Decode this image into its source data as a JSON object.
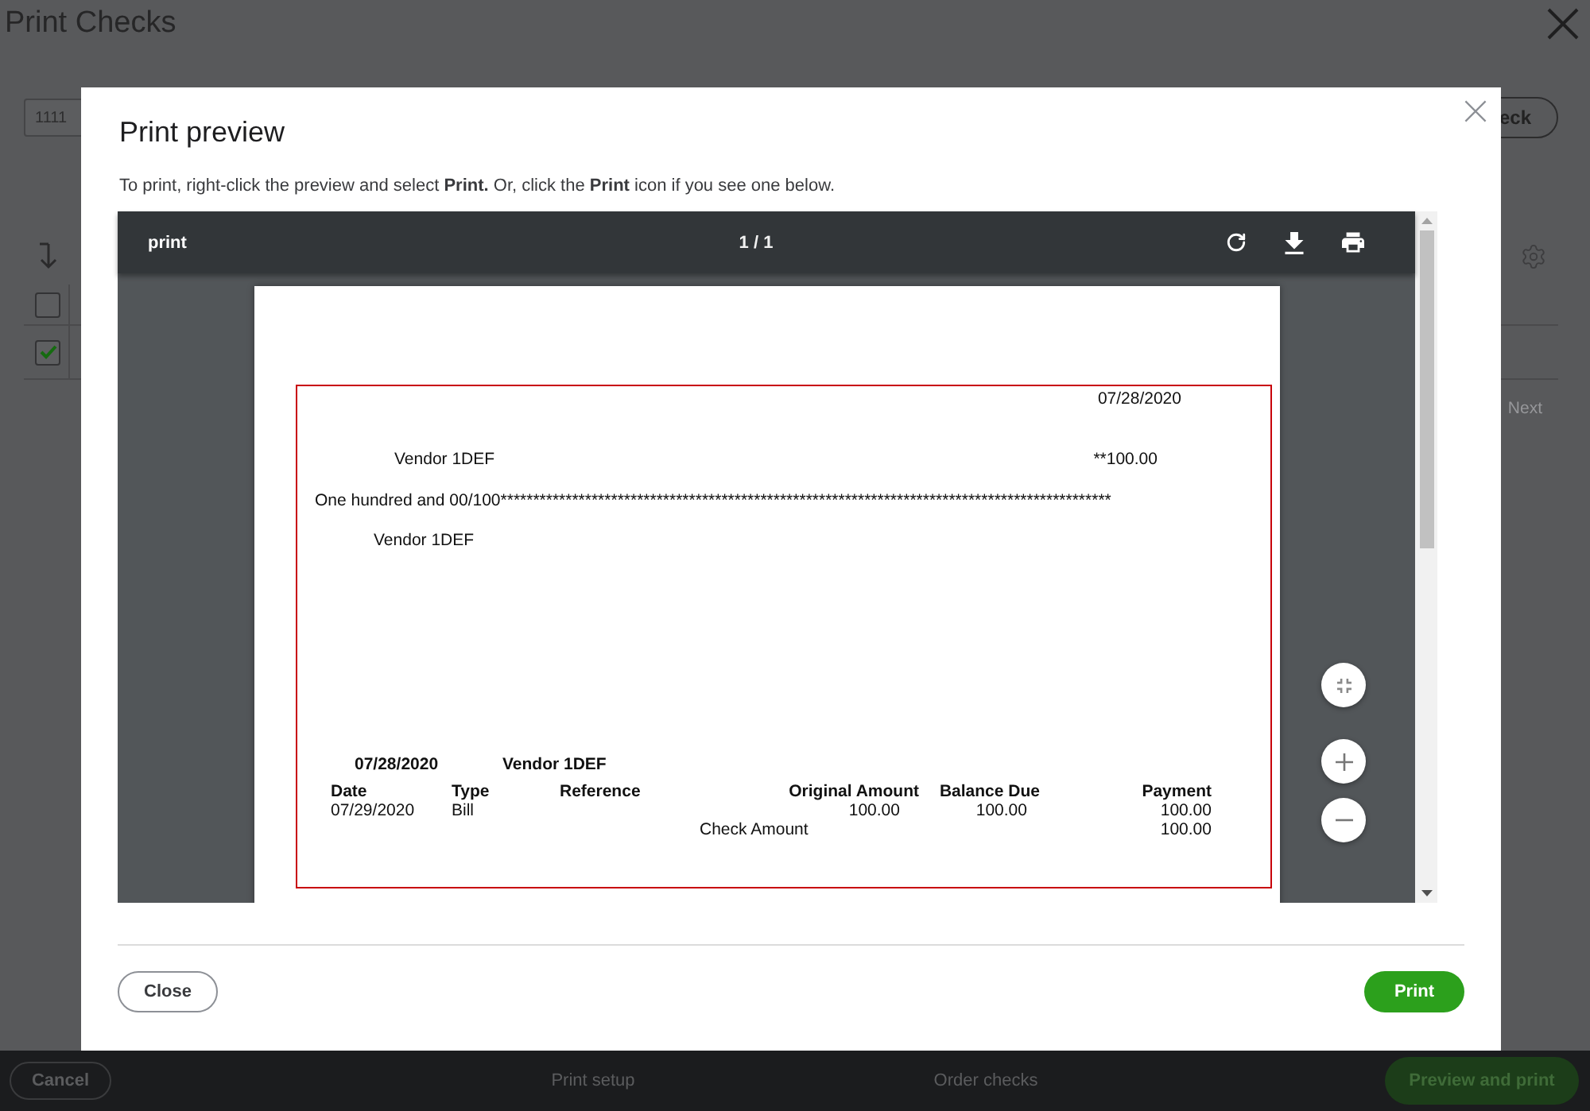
{
  "page": {
    "title": "Print Checks",
    "check_number": "1111",
    "button_text": "eck",
    "rows": [
      {
        "checked": false
      },
      {
        "checked": true
      }
    ],
    "pagination": "Next"
  },
  "dialog": {
    "title": "Print preview",
    "instruction": "To print, right-click the preview and select **Print.** Or, click the **Print** icon if you see one below.",
    "viewer": {
      "document_title": "print",
      "page_indicator": "1 / 1",
      "check": {
        "date": "07/28/2020",
        "payee": "Vendor 1DEF",
        "amount": "**100.00",
        "amount_in_words": "One hundred and 00/100**********************************************************************************************",
        "address": "Vendor 1DEF",
        "stub": {
          "date": "07/28/2020",
          "payee": "Vendor 1DEF",
          "columns": [
            "Date",
            "Type",
            "Reference",
            "Original Amount",
            "Balance Due",
            "Payment"
          ],
          "rows": [
            {
              "date": "07/29/2020",
              "type": "Bill",
              "original_amount": "100.00",
              "balance_due": "100.00",
              "payment": "100.00"
            }
          ],
          "total_label": "Check Amount",
          "total": "100.00"
        }
      }
    },
    "buttons": [
      {
        "label": "Close",
        "kind": "secondary"
      },
      {
        "label": "Print",
        "kind": "primary"
      }
    ]
  },
  "footer": {
    "items": [
      {
        "label": "Cancel",
        "kind": "outline"
      },
      {
        "label": "Print setup",
        "kind": "link"
      },
      {
        "label": "Order checks",
        "kind": "link"
      },
      {
        "label": "Preview and print",
        "kind": "primary"
      }
    ]
  }
}
